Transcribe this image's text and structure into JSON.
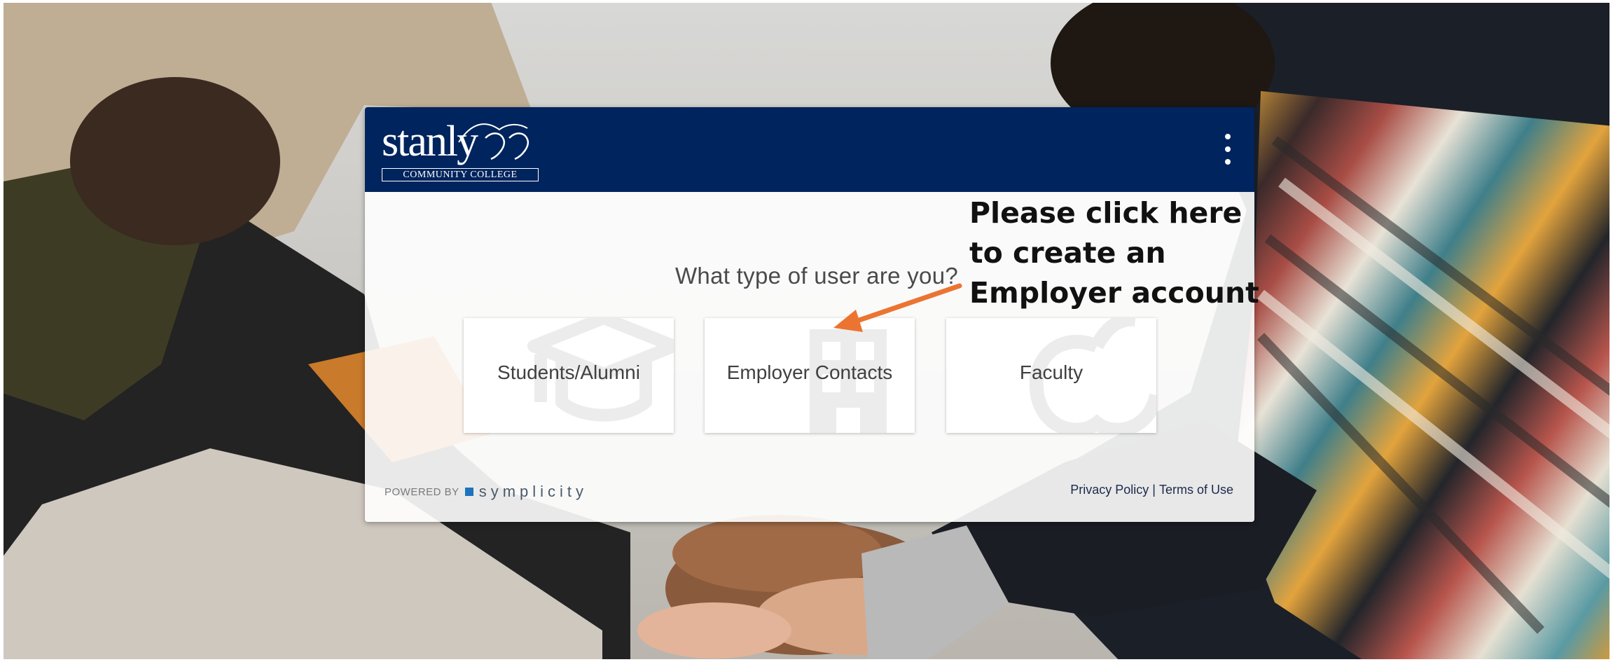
{
  "header": {
    "logo_word": "stanly",
    "logo_sub": "COMMUNITY COLLEGE",
    "menu_icon": "more-vertical-icon"
  },
  "main": {
    "question": "What type of user are you?",
    "options": [
      {
        "label": "Students/Alumni",
        "icon": "graduation-cap-icon"
      },
      {
        "label": "Employer Contacts",
        "icon": "building-icon"
      },
      {
        "label": "Faculty",
        "icon": "apple-icon"
      }
    ]
  },
  "footer": {
    "powered_by": "POWERED BY",
    "brand": "symplicity",
    "privacy": "Privacy Policy",
    "separator": "|",
    "terms": "Terms of Use"
  },
  "annotation": {
    "lines": [
      "Please click here",
      "to create an",
      "Employer account"
    ],
    "arrow_color": "#ec7431"
  },
  "colors": {
    "header_bg": "#00245d",
    "accent": "#1e73be"
  }
}
